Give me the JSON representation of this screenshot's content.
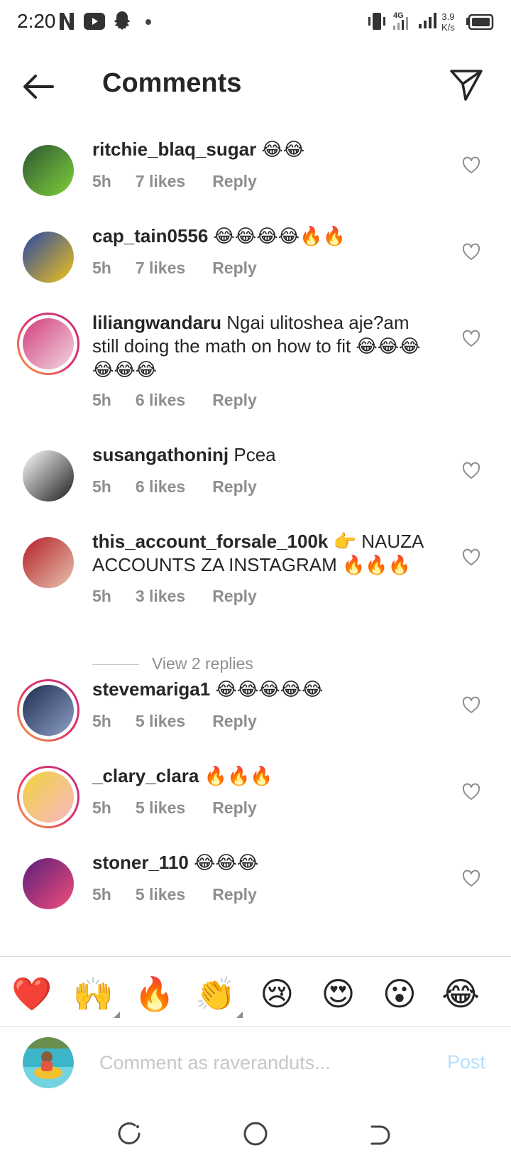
{
  "status_bar": {
    "time": "2:20",
    "network_speed": "3.9",
    "network_speed_unit": "K/s",
    "network_type": "4G"
  },
  "header": {
    "title": "Comments"
  },
  "comments": [
    {
      "username": "ritchie_blaq_sugar",
      "text": "😂😂",
      "time": "5h",
      "likes": "7 likes",
      "reply": "Reply",
      "avatar_colors": [
        "#2c5531",
        "#7fd13b"
      ]
    },
    {
      "username": "cap_tain0556",
      "text": "😂😂😂😂🔥🔥",
      "time": "5h",
      "likes": "7 likes",
      "reply": "Reply",
      "avatar_colors": [
        "#2746a6",
        "#f1c31a"
      ]
    },
    {
      "username": "liliangwandaru",
      "text": "Ngai ulitoshea aje?am still doing the math on how to fit 😂😂😂😂😂😂",
      "time": "5h",
      "likes": "6 likes",
      "reply": "Reply",
      "avatar_colors": [
        "#d23d7d",
        "#f2d7e0"
      ]
    },
    {
      "username": "susangathoninj",
      "text": "Pcea",
      "time": "5h",
      "likes": "6 likes",
      "reply": "Reply",
      "avatar_colors": [
        "#ffffff",
        "#1c1c1c"
      ]
    },
    {
      "username": "this_account_forsale_100k",
      "text": "👉 NAUZA ACCOUNTS ZA INSTAGRAM 🔥🔥🔥",
      "time": "5h",
      "likes": "3 likes",
      "reply": "Reply",
      "avatar_colors": [
        "#b31f2a",
        "#e7c4ad"
      ]
    },
    {
      "username": "stevemariga1",
      "text": "😂😂😂😂😂",
      "time": "5h",
      "likes": "5 likes",
      "reply": "Reply",
      "avatar_colors": [
        "#1d2b4f",
        "#8ea0c6"
      ]
    },
    {
      "username": "_clary_clara",
      "text": "🔥🔥🔥",
      "time": "5h",
      "likes": "5 likes",
      "reply": "Reply",
      "avatar_colors": [
        "#f1d33b",
        "#f6b7c4"
      ]
    },
    {
      "username": "stoner_110",
      "text": "😂😂😂",
      "time": "5h",
      "likes": "5 likes",
      "reply": "Reply",
      "avatar_colors": [
        "#5a1f7a",
        "#f24e7a"
      ]
    }
  ],
  "view_replies": "View 2 replies",
  "emoji_bar": [
    "❤️",
    "🙌",
    "🔥",
    "👏",
    "😢",
    "😍",
    "😮",
    "😂"
  ],
  "composer": {
    "placeholder": "Comment as raverand­uts...",
    "post_label": "Post"
  },
  "colors": {
    "text": "#262626",
    "secondary": "#8e8e8e",
    "post_disabled": "#b2dffc",
    "ring_start": "#f6a23c",
    "ring_end": "#c13584"
  }
}
